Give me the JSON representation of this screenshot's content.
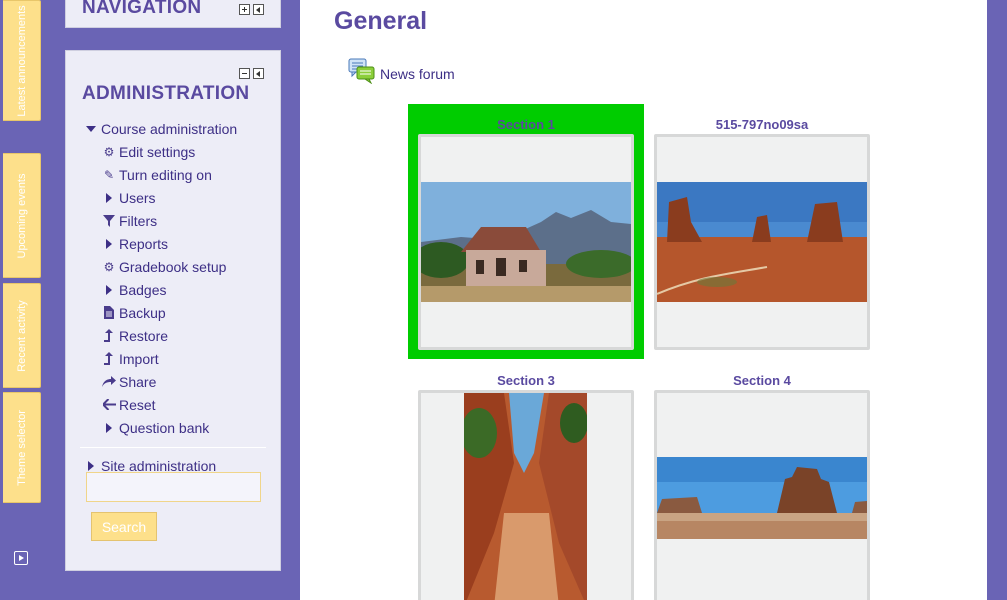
{
  "dock": {
    "tabs": [
      "Latest announcements",
      "Upcoming events",
      "Recent activity",
      "Theme selector"
    ]
  },
  "navigation_block": {
    "title": "NAVIGATION"
  },
  "admin_block": {
    "title": "ADMINISTRATION",
    "course_admin": "Course administration",
    "items": [
      {
        "label": "Edit settings",
        "icon": "gear-icon"
      },
      {
        "label": "Turn editing on",
        "icon": "pencil-icon"
      },
      {
        "label": "Users",
        "icon": "expand-arrow-icon"
      },
      {
        "label": "Filters",
        "icon": "filter-icon"
      },
      {
        "label": "Reports",
        "icon": "expand-arrow-icon"
      },
      {
        "label": "Gradebook setup",
        "icon": "gear-icon"
      },
      {
        "label": "Badges",
        "icon": "expand-arrow-icon"
      },
      {
        "label": "Backup",
        "icon": "file-icon"
      },
      {
        "label": "Restore",
        "icon": "upload-icon"
      },
      {
        "label": "Import",
        "icon": "upload-icon"
      },
      {
        "label": "Share",
        "icon": "share-icon"
      },
      {
        "label": "Reset",
        "icon": "arrow-left-icon"
      },
      {
        "label": "Question bank",
        "icon": "expand-arrow-icon"
      }
    ],
    "site_admin": "Site administration",
    "search_button": "Search"
  },
  "main": {
    "title": "General",
    "forum_label": "News forum",
    "sections": [
      {
        "title": "Section 1",
        "highlighted": true
      },
      {
        "title": "515-797no09sa",
        "highlighted": false
      },
      {
        "title": "Section 3",
        "highlighted": false
      },
      {
        "title": "Section 4",
        "highlighted": false
      }
    ]
  },
  "colors": {
    "purple_bg": "#6a64b5",
    "accent": "#5a4aa0",
    "highlight": "#00cc00",
    "dock_tab": "#fde08b"
  }
}
